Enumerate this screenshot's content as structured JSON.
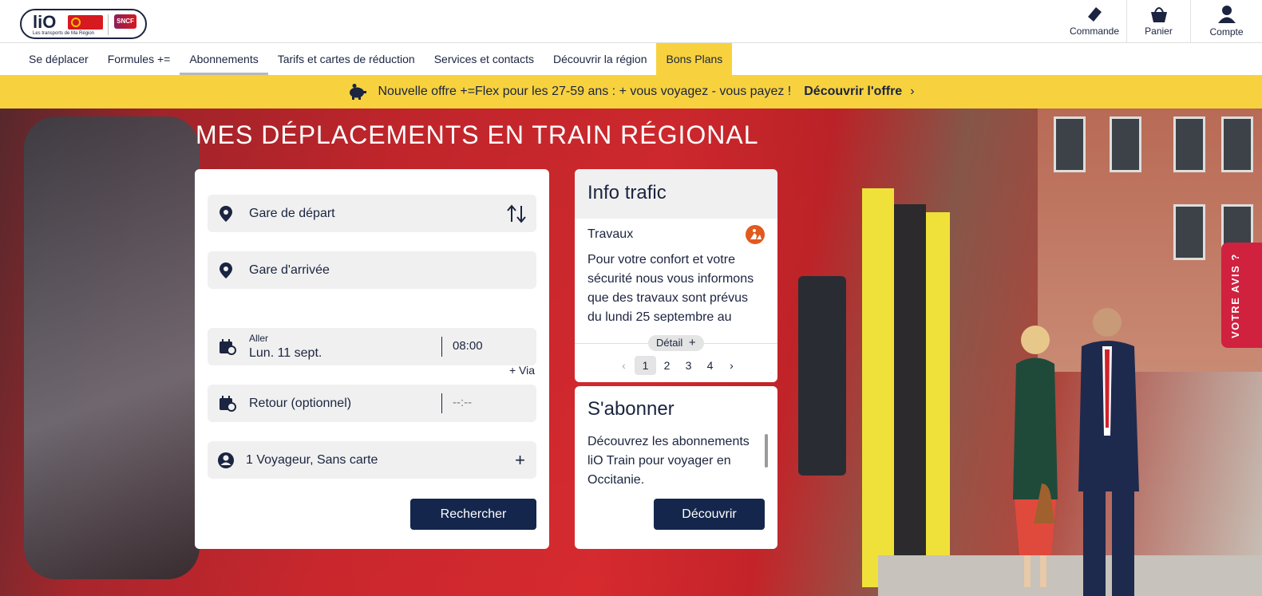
{
  "brand": {
    "logo_text": "liO",
    "logo_tagline": "Les transports de Ma Région",
    "partner_badge": "SNCF"
  },
  "header_actions": [
    {
      "label": "Commande",
      "icon": "ticket-icon"
    },
    {
      "label": "Panier",
      "icon": "basket-icon"
    },
    {
      "label": "Compte",
      "icon": "user-icon"
    }
  ],
  "nav": [
    {
      "label": "Se déplacer"
    },
    {
      "label": "Formules +="
    },
    {
      "label": "Abonnements",
      "active": true
    },
    {
      "label": "Tarifs et cartes de réduction"
    },
    {
      "label": "Services et contacts"
    },
    {
      "label": "Découvrir la région"
    },
    {
      "label": "Bons Plans",
      "highlight": true
    }
  ],
  "banner": {
    "icon": "piggy-bank-icon",
    "text": "Nouvelle offre +=Flex pour les 27-59 ans : + vous voyagez - vous payez !",
    "link": "Découvrir l'offre",
    "chevron": "›"
  },
  "hero": {
    "title": "MES DÉPLACEMENTS EN TRAIN RÉGIONAL"
  },
  "search": {
    "departure_placeholder": "Gare de départ",
    "arrival_placeholder": "Gare d'arrivée",
    "via_label": "+ Via",
    "outbound_label": "Aller",
    "outbound_date": "Lun. 11 sept.",
    "outbound_time": "08:00",
    "return_placeholder": "Retour (optionnel)",
    "return_time_placeholder": "--:--",
    "travelers": "1 Voyageur, Sans carte",
    "add_symbol": "+",
    "submit": "Rechercher"
  },
  "info_trafic": {
    "title": "Info trafic",
    "type": "Travaux",
    "message": "Pour votre confort et votre sécurité nous vous informons que des travaux sont prévus du lundi 25 septembre au",
    "detail_label": "Détail",
    "detail_symbol": "+",
    "pages": [
      "1",
      "2",
      "3",
      "4"
    ],
    "current_page": "1",
    "prev": "‹",
    "next": "›"
  },
  "subscribe": {
    "title": "S'abonner",
    "text": "Découvrez les abonnements liO Train pour voyager en Occitanie.",
    "button": "Découvrir"
  },
  "feedback_tab": "VOTRE AVIS ?",
  "colors": {
    "navy": "#14264c",
    "yellow": "#f7d23e",
    "feedback_red": "#d0213f",
    "works_orange": "#e15a1e"
  }
}
